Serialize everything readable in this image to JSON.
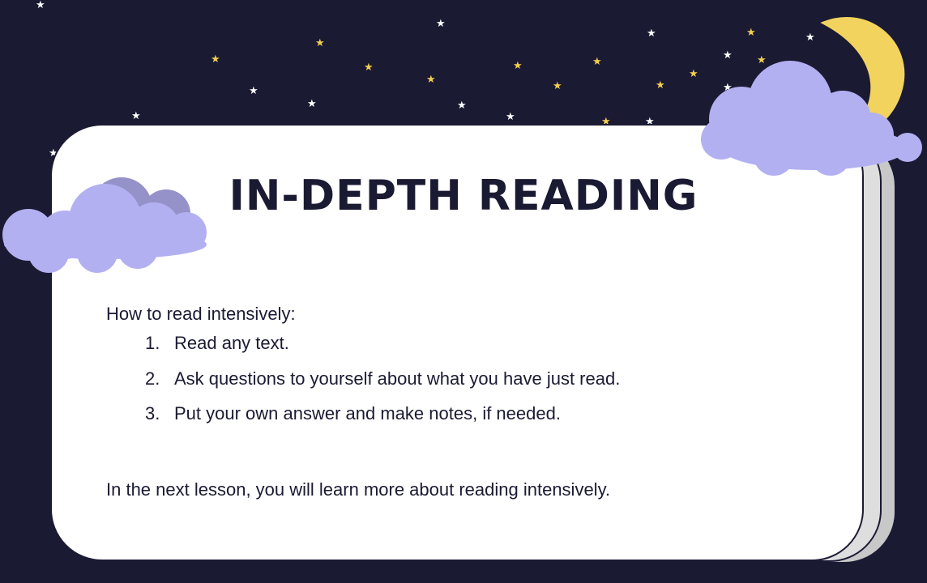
{
  "slide": {
    "title": "IN-DEPTH READING",
    "intro": "How to read intensively:",
    "steps": [
      {
        "number": "1.",
        "text": "Read any text."
      },
      {
        "number": "2.",
        "text": "Ask questions to yourself about what you have just read."
      },
      {
        "number": "3.",
        "text": "Put your own answer and make notes, if needed."
      }
    ],
    "outro": "In the next lesson, you will learn more about reading intensively."
  },
  "colors": {
    "background": "#1b1a33",
    "card": "#ffffff",
    "cloud": "#b3b0f2",
    "cloud_shade": "#9591c9",
    "moon": "#f2d35e",
    "star_white": "#ffffff",
    "star_yellow": "#f3cf4e"
  },
  "icons": [
    "moon-icon",
    "cloud-icon",
    "star-icon"
  ]
}
